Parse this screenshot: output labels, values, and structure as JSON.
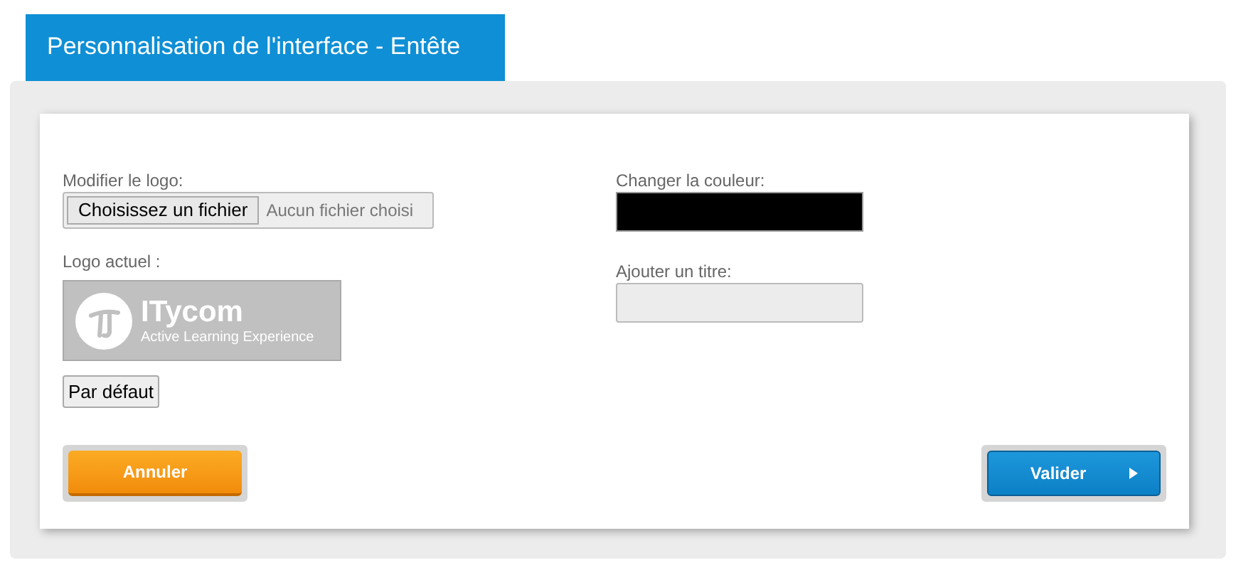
{
  "tab": {
    "label": "Personnalisation de l'interface - Entête"
  },
  "logo_field": {
    "label": "Modifier le logo:",
    "button": "Choisissez un fichier",
    "status": "Aucun fichier choisi"
  },
  "current_logo": {
    "label": "Logo actuel :",
    "name": "ITycom",
    "tagline": "Active Learning Experience"
  },
  "default_button": "Par défaut",
  "color_field": {
    "label": "Changer la couleur:",
    "color": "#000000"
  },
  "title_field": {
    "label": "Ajouter un titre:"
  },
  "buttons": [
    {
      "label": "Annuler",
      "kind": "cancel"
    },
    {
      "label": "Valider",
      "kind": "submit"
    }
  ]
}
